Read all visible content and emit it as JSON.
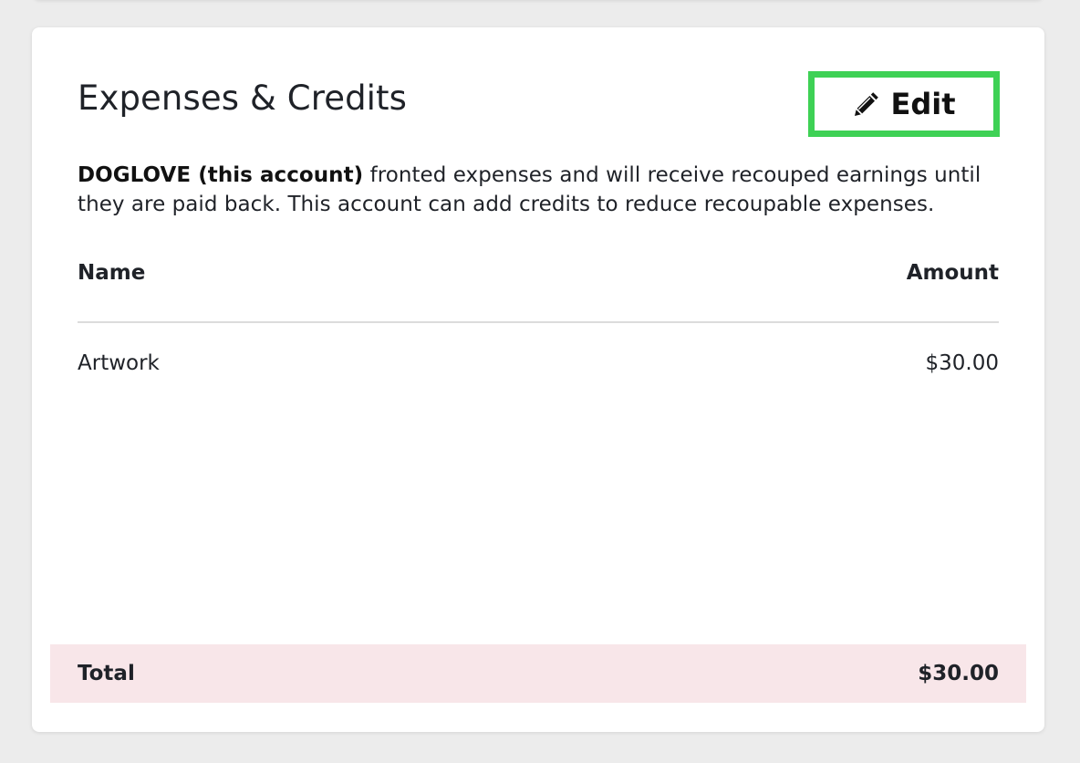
{
  "card": {
    "title": "Expenses & Credits",
    "edit_button": {
      "icon": "pencil-icon",
      "label": "Edit",
      "highlight_color": "#3ed155"
    },
    "description": {
      "owner": "DOGLOVE (this account)",
      "text": " fronted expenses and will receive recouped earnings until they are paid back. This account can add credits to reduce recoupable expenses."
    },
    "table": {
      "columns": [
        "Name",
        "Amount"
      ],
      "rows": [
        {
          "name": "Artwork",
          "amount": "$30.00"
        }
      ]
    },
    "total": {
      "label": "Total",
      "amount": "$30.00",
      "background": "#f8e6e9"
    }
  }
}
